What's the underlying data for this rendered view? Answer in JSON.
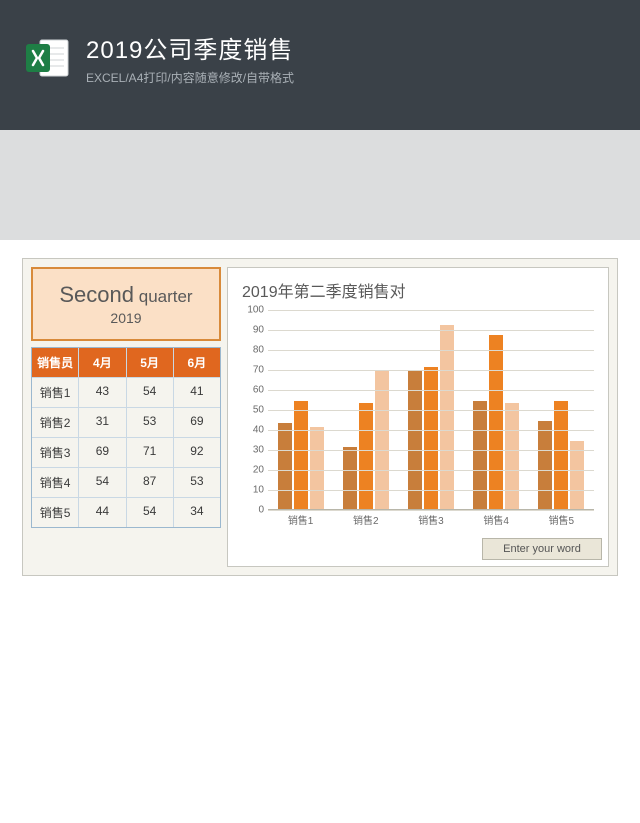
{
  "header": {
    "title": "2019公司季度销售",
    "subtitle": "EXCEL/A4打印/内容随意修改/自带格式"
  },
  "quarter_box": {
    "word1": "Second",
    "word2": "quarter",
    "year": "2019"
  },
  "table": {
    "headers": [
      "销售员",
      "4月",
      "5月",
      "6月"
    ],
    "rows": [
      [
        "销售1",
        "43",
        "54",
        "41"
      ],
      [
        "销售2",
        "31",
        "53",
        "69"
      ],
      [
        "销售3",
        "69",
        "71",
        "92"
      ],
      [
        "销售4",
        "54",
        "87",
        "53"
      ],
      [
        "销售5",
        "44",
        "54",
        "34"
      ]
    ]
  },
  "entry_placeholder": "Enter your word",
  "chart_data": {
    "type": "bar",
    "title": "2019年第二季度销售对",
    "categories": [
      "销售1",
      "销售2",
      "销售3",
      "销售4",
      "销售5"
    ],
    "series": [
      {
        "name": "4月",
        "color": "#c87e3b",
        "values": [
          43,
          31,
          69,
          54,
          44
        ]
      },
      {
        "name": "5月",
        "color": "#ed8222",
        "values": [
          54,
          53,
          71,
          87,
          54
        ]
      },
      {
        "name": "6月",
        "color": "#f3c5a0",
        "values": [
          41,
          69,
          92,
          53,
          34
        ]
      }
    ],
    "ylim": [
      0,
      100
    ],
    "y_ticks": [
      0,
      10,
      20,
      30,
      40,
      50,
      60,
      70,
      80,
      90,
      100
    ],
    "xlabel": "",
    "ylabel": ""
  }
}
